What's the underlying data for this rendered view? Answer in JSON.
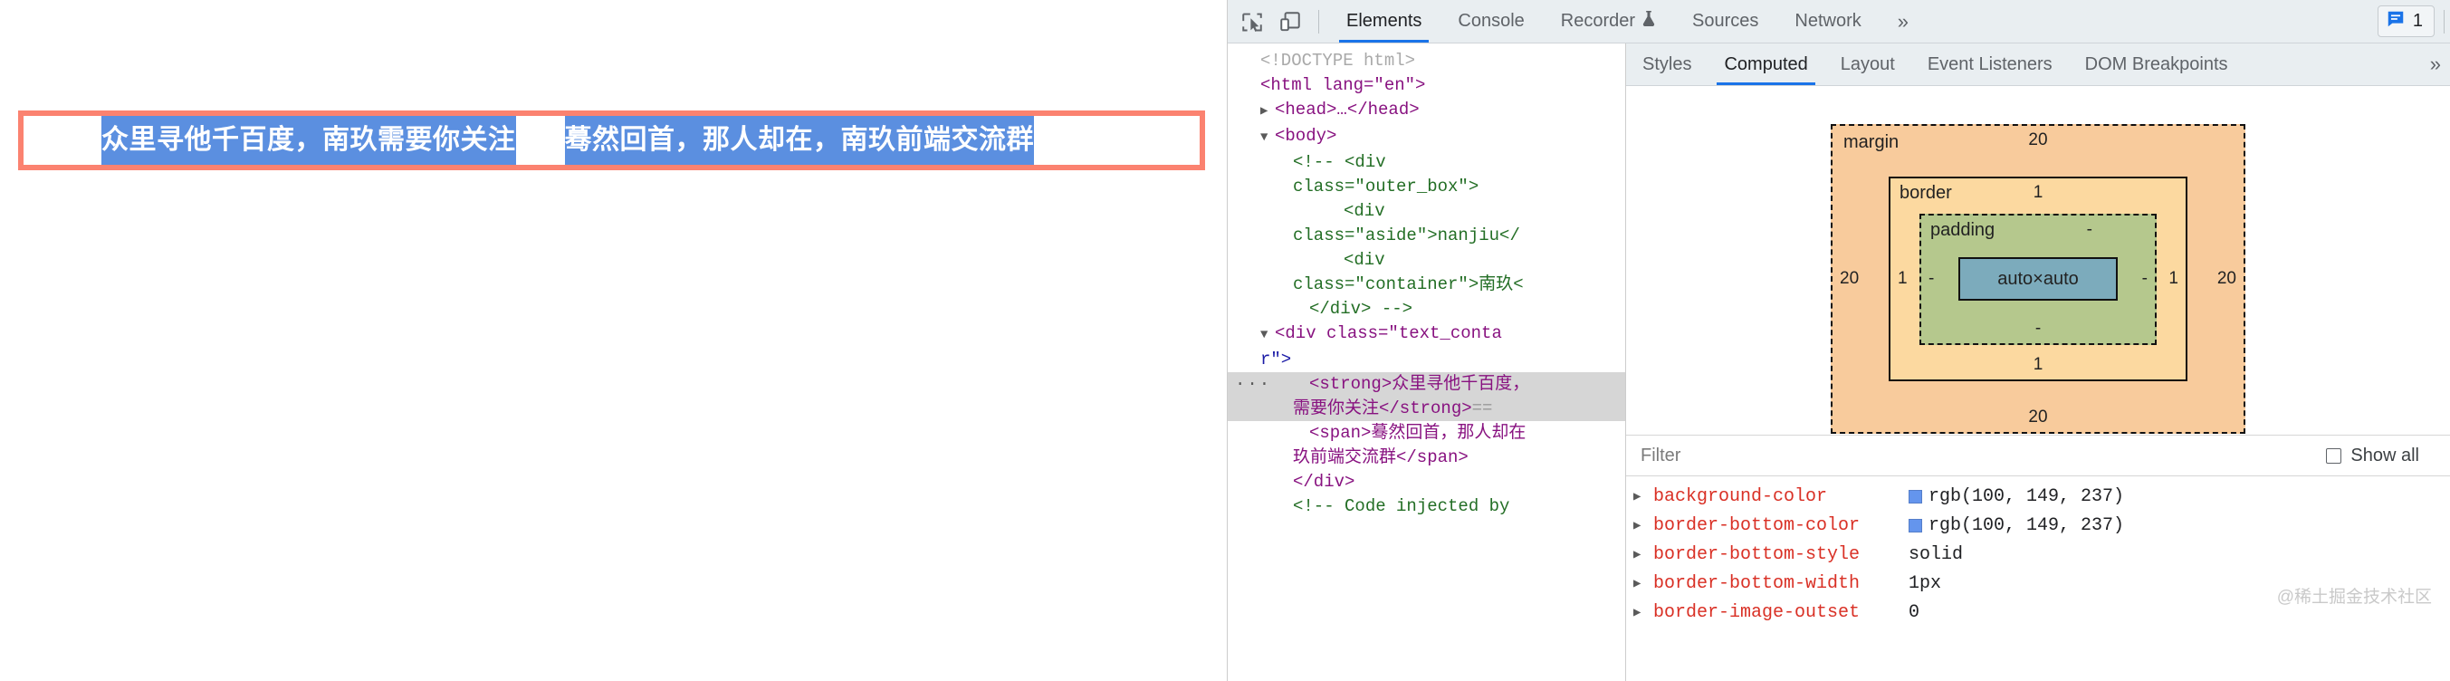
{
  "page": {
    "strong_text": "众里寻他千百度，南玖需要你关注",
    "span_text": "蓦然回首，那人却在，南玖前端交流群"
  },
  "devtools": {
    "toolbar": {
      "inspect_icon": "inspect-element-icon",
      "device_icon": "device-toolbar-icon",
      "tabs": [
        {
          "label": "Elements",
          "active": true
        },
        {
          "label": "Console",
          "active": false
        },
        {
          "label": "Recorder",
          "active": false,
          "badge": "flask-icon"
        },
        {
          "label": "Sources",
          "active": false
        },
        {
          "label": "Network",
          "active": false
        }
      ],
      "more_tabs_icon": "»",
      "issues_count": "1",
      "issues_icon": "issues-message-icon"
    },
    "dom": {
      "doctype": "<!DOCTYPE html>",
      "html_open": "<html lang=\"en\">",
      "head_line": "<head>…</head>",
      "body_open": "<body>",
      "comment_l1": "<!-- <div",
      "comment_l2": "class=\"outer_box\">",
      "comment_l3": "<div",
      "comment_l4": "class=\"aside\">nanjiu</",
      "comment_l5": "<div",
      "comment_l6": "class=\"container\">南玖<",
      "comment_l7": "</div> -->",
      "textcontainer_open_a": "<div class=\"text_conta",
      "textcontainer_open_b": "r\">",
      "strong_line_a": "<strong>众里寻他千百度，",
      "strong_line_b": "需要你关注</strong>",
      "strong_marker": "==",
      "span_line_a": "<span>蓦然回首，那人却在",
      "span_line_b": "玖前端交流群</span>",
      "div_close": "</div>",
      "injected_comment": "<!-- Code injected by",
      "ellipsis_marker": "···"
    },
    "subtabs": [
      {
        "label": "Styles",
        "active": false
      },
      {
        "label": "Computed",
        "active": true
      },
      {
        "label": "Layout",
        "active": false
      },
      {
        "label": "Event Listeners",
        "active": false
      },
      {
        "label": "DOM Breakpoints",
        "active": false
      }
    ],
    "subtabs_more_icon": "»",
    "box_model": {
      "margin_label": "margin",
      "margin_top": "20",
      "margin_right": "20",
      "margin_bottom": "20",
      "margin_left": "20",
      "border_label": "border",
      "border_top": "1",
      "border_right": "1",
      "border_bottom": "1",
      "border_left": "1",
      "padding_label": "padding",
      "padding_top": "-",
      "padding_right": "-",
      "padding_bottom": "-",
      "padding_left": "-",
      "content_size": "auto×auto",
      "colors": {
        "margin": "#f8cb9c",
        "border": "#fcd9a0",
        "padding": "#b5c88d",
        "content": "#7cabbc"
      }
    },
    "filter": {
      "placeholder": "Filter",
      "value": "",
      "show_all_label": "Show all",
      "show_all_checked": false
    },
    "computed_props": [
      {
        "name": "background-color",
        "value": "rgb(100, 149, 237)",
        "swatch": "#6495ed"
      },
      {
        "name": "border-bottom-color",
        "value": "rgb(100, 149, 237)",
        "swatch": "#6495ed"
      },
      {
        "name": "border-bottom-style",
        "value": "solid",
        "swatch": null
      },
      {
        "name": "border-bottom-width",
        "value": "1px",
        "swatch": null
      },
      {
        "name": "border-image-outset",
        "value": "0",
        "swatch": null
      }
    ],
    "watermark": "@稀土掘金技术社区"
  }
}
